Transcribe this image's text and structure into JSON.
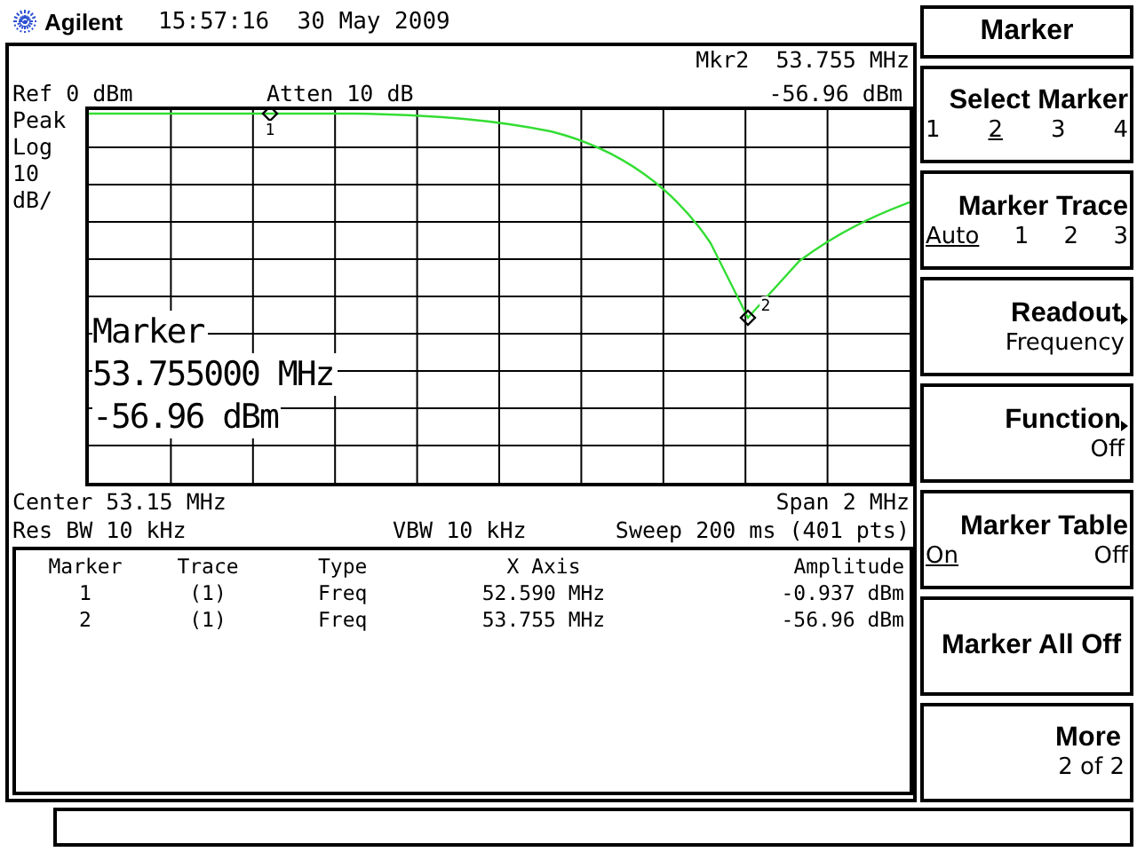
{
  "header": {
    "brand": "Agilent",
    "datetime": "15:57:16  30 May 2009"
  },
  "display": {
    "marker_readout": "Mkr2  53.755 MHz",
    "ref_level": "Ref 0 dBm",
    "attenuation": "Atten 10 dB",
    "marker_amplitude": "-56.96 dBm",
    "scale_labels": [
      "Peak",
      "Log",
      "10",
      "dB/"
    ],
    "trace_markers": [
      {
        "label": "1"
      },
      {
        "label": "2"
      }
    ],
    "marker_overlay": [
      "Marker",
      "53.755000 MHz",
      "-56.96 dBm"
    ],
    "center": "Center 53.15 MHz",
    "span": "Span 2 MHz",
    "res_bw": "Res BW 10 kHz",
    "vbw": "VBW 10 kHz",
    "sweep": "Sweep 200 ms (401 pts)"
  },
  "marker_table": {
    "columns": [
      "Marker",
      "Trace",
      "Type",
      "X Axis",
      "Amplitude"
    ],
    "rows": [
      [
        "1",
        "(1)",
        "Freq",
        "52.590 MHz",
        "-0.937 dBm"
      ],
      [
        "2",
        "(1)",
        "Freq",
        "53.755 MHz",
        "-56.96 dBm"
      ]
    ]
  },
  "softkeys": {
    "title": "Marker",
    "keys": [
      {
        "kind": "choice",
        "label": "Select Marker",
        "options": [
          {
            "text": "1",
            "selected": false
          },
          {
            "text": "2",
            "selected": true
          },
          {
            "text": "3",
            "selected": false
          },
          {
            "text": "4",
            "selected": false
          }
        ]
      },
      {
        "kind": "choice",
        "label": "Marker Trace",
        "options": [
          {
            "text": "Auto",
            "selected": true
          },
          {
            "text": "1",
            "selected": false
          },
          {
            "text": "2",
            "selected": false
          },
          {
            "text": "3",
            "selected": false
          }
        ]
      },
      {
        "kind": "submenu",
        "label": "Readout",
        "value": "Frequency"
      },
      {
        "kind": "submenu",
        "label": "Function",
        "value": "Off"
      },
      {
        "kind": "choice",
        "label": "Marker Table",
        "options": [
          {
            "text": "On",
            "selected": true
          },
          {
            "text": "Off",
            "selected": false
          }
        ]
      },
      {
        "kind": "action",
        "label": "Marker All Off"
      },
      {
        "kind": "page",
        "label": "More",
        "value": "2 of 2"
      }
    ]
  }
}
